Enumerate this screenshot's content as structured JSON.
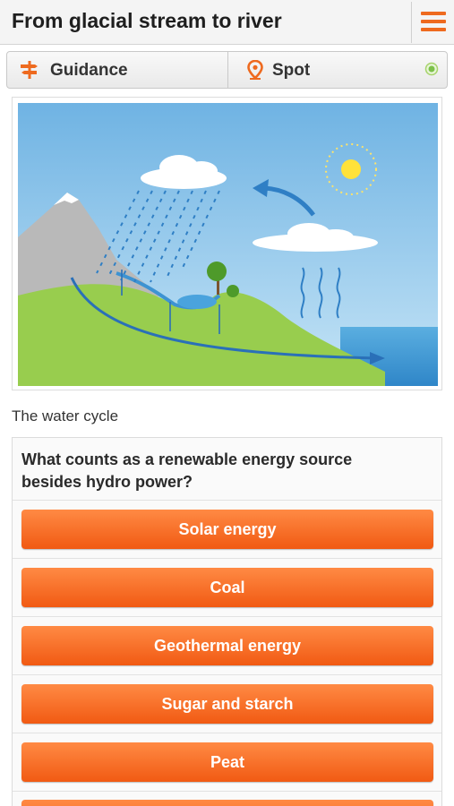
{
  "header": {
    "title": "From glacial stream to river",
    "menu_icon": "hamburger-menu-icon",
    "accent_color": "#ee6a1f"
  },
  "tabs": [
    {
      "label": "Guidance",
      "icon": "signpost-icon"
    },
    {
      "label": "Spot",
      "icon": "location-pin-icon",
      "status_icon": "status-dot-icon",
      "status_color": "#8bc34a"
    }
  ],
  "figure": {
    "caption": "The water cycle"
  },
  "quiz": {
    "question": "What counts as a renewable energy source besides hydro power?",
    "answers": [
      "Solar energy",
      "Coal",
      "Geothermal energy",
      "Sugar and starch",
      "Peat"
    ],
    "button_color": "#f26a22"
  }
}
